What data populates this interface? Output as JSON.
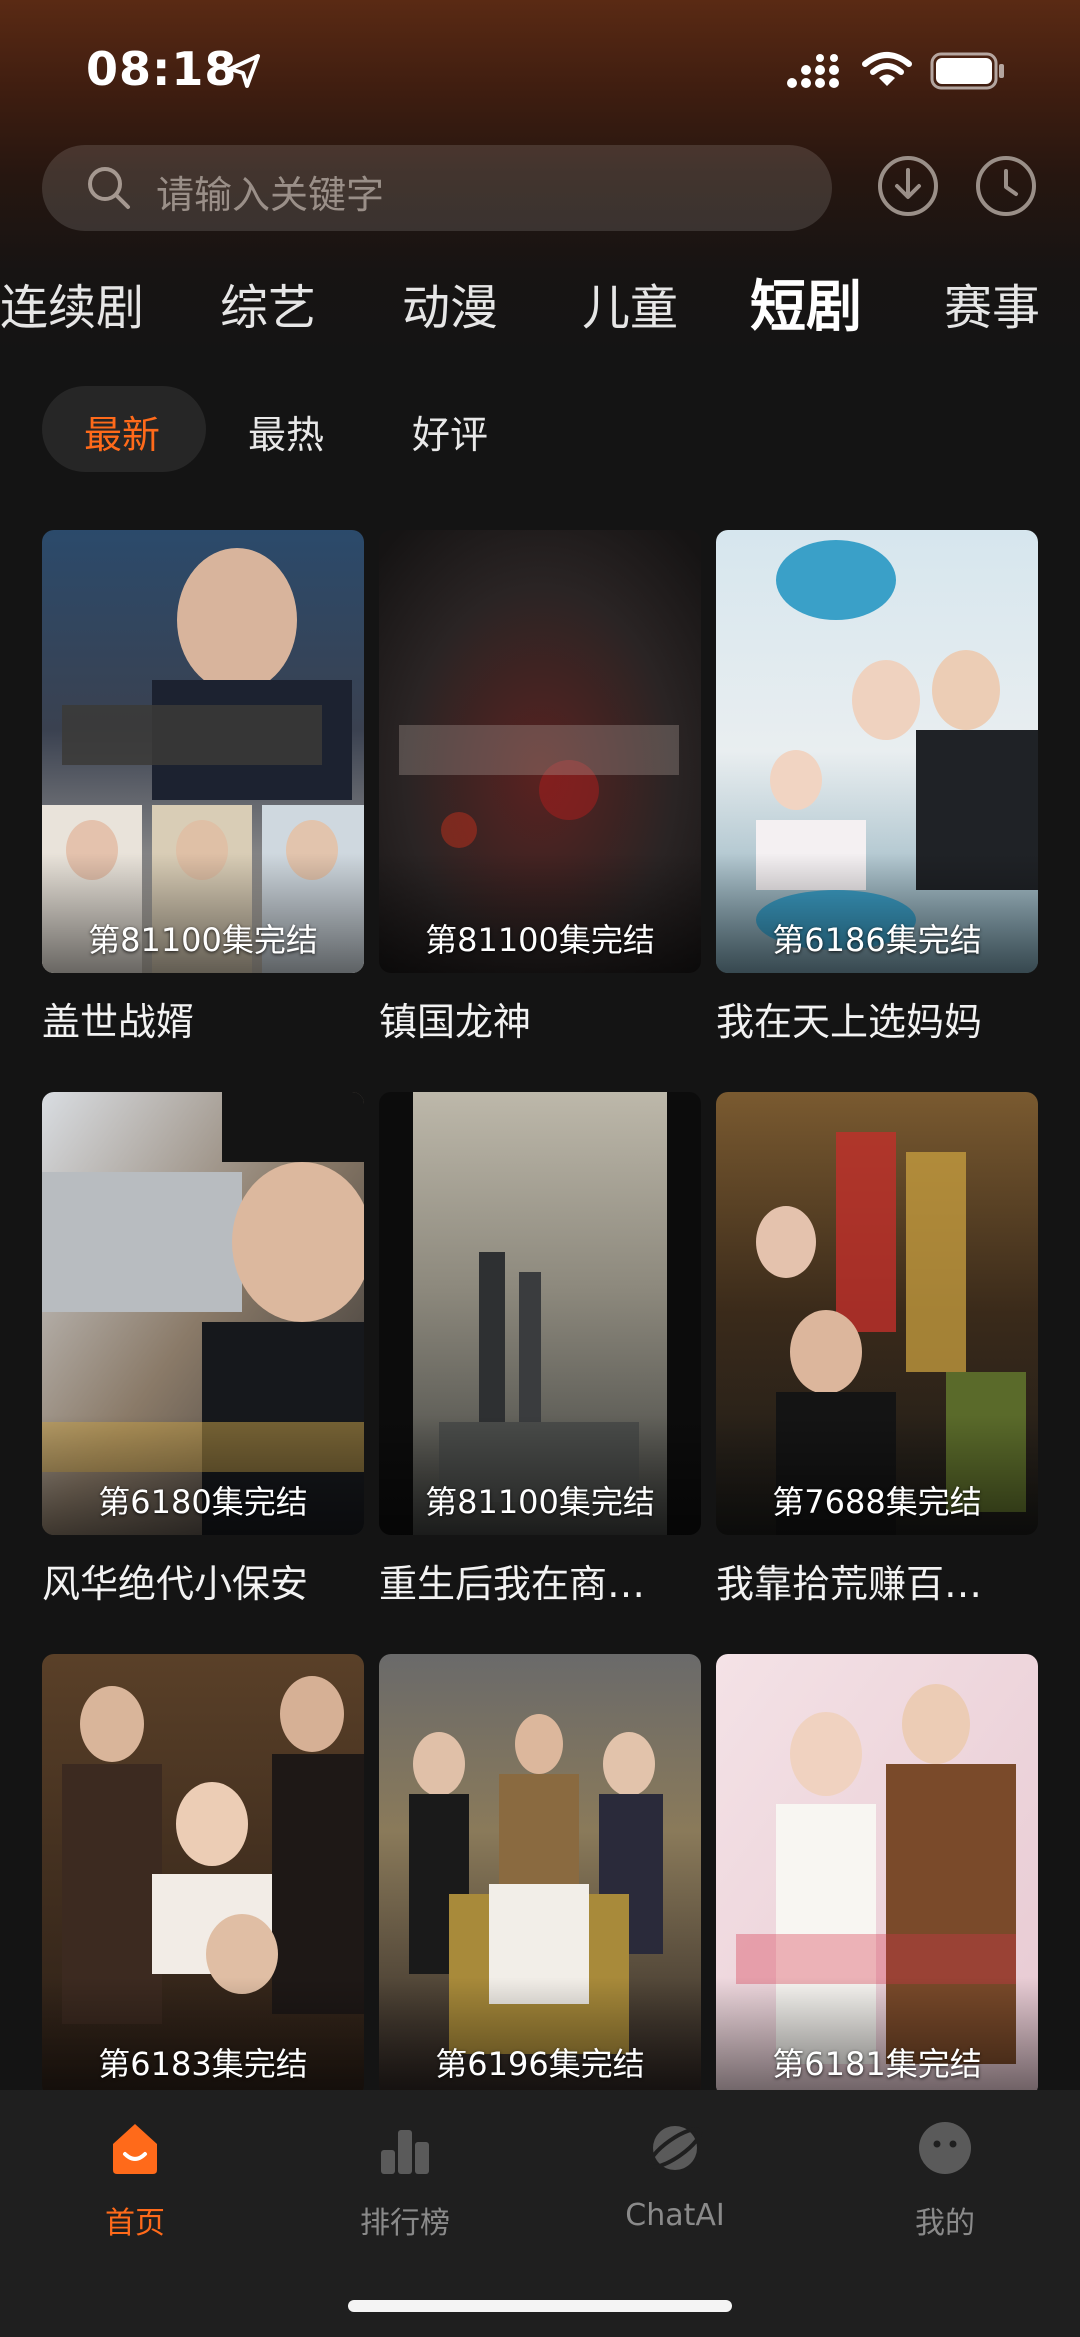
{
  "status_bar": {
    "time": "08:18"
  },
  "search": {
    "placeholder": "请输入关键字"
  },
  "category_tabs": [
    {
      "label": "连续剧"
    },
    {
      "label": "综艺"
    },
    {
      "label": "动漫"
    },
    {
      "label": "儿童"
    },
    {
      "label": "短剧",
      "active": true
    },
    {
      "label": "赛事"
    }
  ],
  "filters": [
    {
      "label": "最新",
      "active": true
    },
    {
      "label": "最热"
    },
    {
      "label": "好评"
    }
  ],
  "dramas": [
    {
      "title": "盖世战婿",
      "episodes": "第81100集完结"
    },
    {
      "title": "镇国龙神",
      "episodes": "第81100集完结"
    },
    {
      "title": "我在天上选妈妈",
      "episodes": "第6186集完结"
    },
    {
      "title": "风华绝代小保安",
      "episodes": "第6180集完结"
    },
    {
      "title": "重生后我在商…",
      "episodes": "第81100集完结"
    },
    {
      "title": "我靠拾荒赚百…",
      "episodes": "第7688集完结"
    },
    {
      "title": "",
      "episodes": "第6183集完结"
    },
    {
      "title": "",
      "episodes": "第6196集完结"
    },
    {
      "title": "",
      "episodes": "第6181集完结"
    }
  ],
  "bottom_nav": [
    {
      "label": "首页",
      "icon": "home-icon",
      "active": true
    },
    {
      "label": "排行榜",
      "icon": "ranking-icon"
    },
    {
      "label": "ChatAI",
      "icon": "chatai-planet-icon"
    },
    {
      "label": "我的",
      "icon": "profile-face-icon"
    }
  ],
  "colors": {
    "accent": "#ff6a1a",
    "background": "#141414",
    "header_top": "#5a2a14"
  }
}
